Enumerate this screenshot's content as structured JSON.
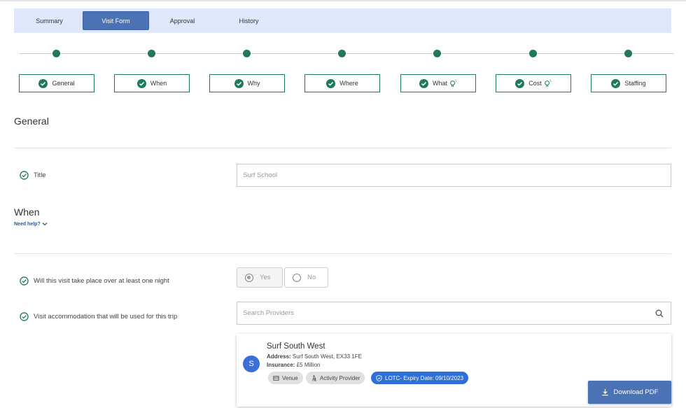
{
  "tabs": [
    {
      "label": "Summary",
      "active": false
    },
    {
      "label": "Visit Form",
      "active": true
    },
    {
      "label": "Approval",
      "active": false
    },
    {
      "label": "History",
      "active": false
    }
  ],
  "steps": [
    {
      "label": "General",
      "hint": false
    },
    {
      "label": "When",
      "hint": false
    },
    {
      "label": "Why",
      "hint": false
    },
    {
      "label": "Where",
      "hint": false
    },
    {
      "label": "What",
      "hint": true
    },
    {
      "label": "Cost",
      "hint": true
    },
    {
      "label": "Staffing",
      "hint": false
    }
  ],
  "general": {
    "heading": "General",
    "title_label": "Title",
    "title_value": "Surf School"
  },
  "when": {
    "heading": "When",
    "need_help": "Need help?",
    "night_label": "Will this visit take place over at least one night",
    "yes_label": "Yes",
    "no_label": "No",
    "accommodation_label": "Visit accommodation that will be used for this trip",
    "search_placeholder": "Search Providers"
  },
  "provider": {
    "avatar_letter": "S",
    "name": "Surf South West",
    "address_label": "Address:",
    "address_value": "Surf South West, EX33 1FE",
    "insurance_label": "Insurance:",
    "insurance_value": "£5 Million",
    "chips": {
      "venue": "Venue",
      "activity": "Activity Provider",
      "lotc": "LOTC- Expiry Date: 09/10/2023"
    }
  },
  "download_label": "Download PDF",
  "colors": {
    "accent": "#4a72b5",
    "success": "#1f7a5a",
    "tabbar_bg": "#dfe8fb",
    "chip_blue": "#2f6fd8"
  }
}
